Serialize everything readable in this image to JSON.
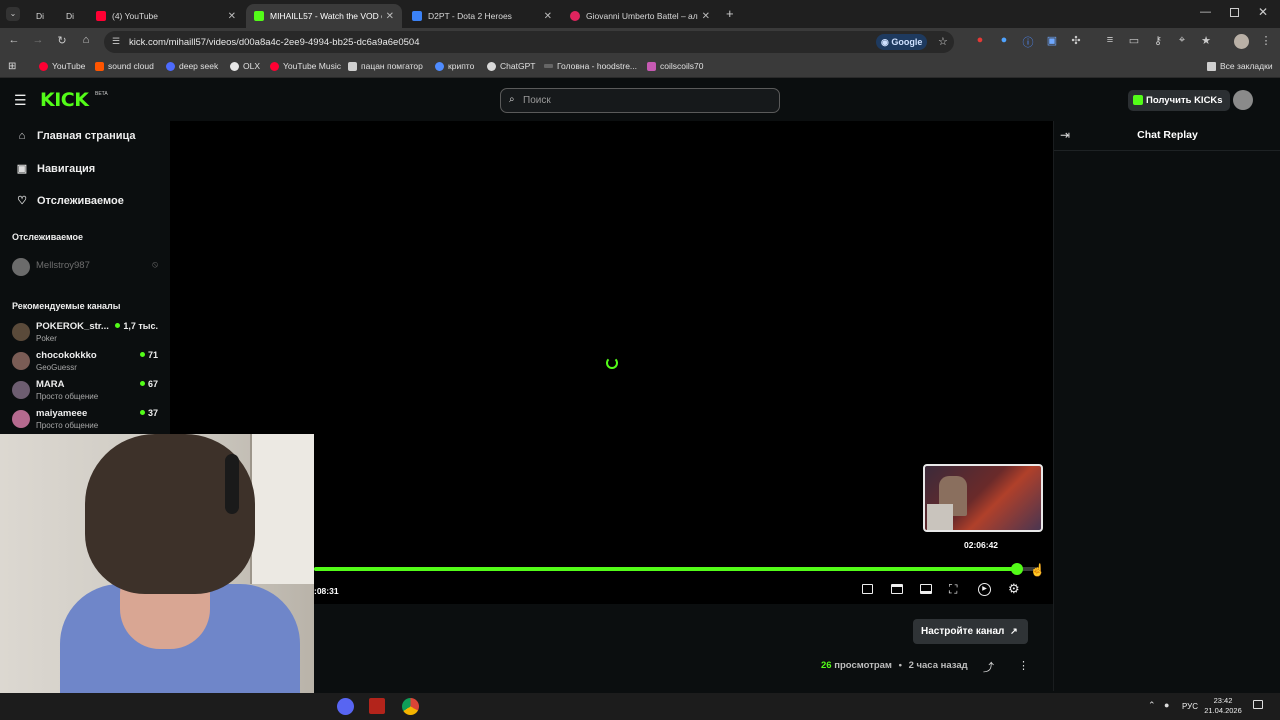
{
  "browser": {
    "tabs": [
      {
        "label": "Di",
        "color": "#5a5a5a"
      },
      {
        "label": "Di",
        "color": "#5a5a5a"
      },
      {
        "label": "(4) YouTube",
        "color": "#ff0033"
      },
      {
        "label": "MIHAILL57 - Watch the VOD o",
        "color": "#53fc18"
      },
      {
        "label": "D2PT - Dota 2 Heroes",
        "color": "#3b82f6"
      },
      {
        "label": "Giovanni Umberto Battel – аль",
        "color": "#e0245e"
      }
    ],
    "url": "kick.com/mihaill57/videos/d00a8a4c-2ee9-4994-bb25-dc6a9a6e0504",
    "google_label": "Google",
    "bookmarks": [
      "YouTube",
      "sound cloud",
      "deep seek",
      "OLX",
      "YouTube Music",
      "пацан помгатор",
      "крипто",
      "ChatGPT",
      "Головна - hoodstre...",
      "coilscoils70"
    ],
    "all_bookmarks": "Все закладки"
  },
  "kick": {
    "logo": "KICK",
    "logo_beta": "BETA",
    "search_placeholder": "Поиск",
    "get_kicks": "Получить KICKs",
    "nav": [
      "Главная страница",
      "Навигация",
      "Отслеживаемое"
    ],
    "following_heading": "Отслеживаемое",
    "following_channel": "Mellstroy987",
    "recommended_heading": "Рекомендуемые каналы",
    "channels": [
      {
        "name": "POKEROK_str...",
        "category": "Poker",
        "viewers": "1,7 тыс."
      },
      {
        "name": "chocokokkko",
        "category": "GeoGuessr",
        "viewers": "71"
      },
      {
        "name": "MARA",
        "category": "Просто общение",
        "viewers": "67"
      },
      {
        "name": "maiyameee",
        "category": "Просто общение",
        "viewers": "37"
      }
    ],
    "chat_title": "Chat Replay",
    "player": {
      "preview_time": "02:06:42",
      "current_time": ":08:31",
      "progress": 0.97
    },
    "configure_channel": "Настройте канал",
    "views_count": "26",
    "views_label": "просмотрам",
    "ago": "2 часа назад"
  },
  "taskbar": {
    "lang": "РУС",
    "time": "23:42",
    "date": "21.04.2026"
  },
  "colors": {
    "accent": "#53fc18"
  }
}
